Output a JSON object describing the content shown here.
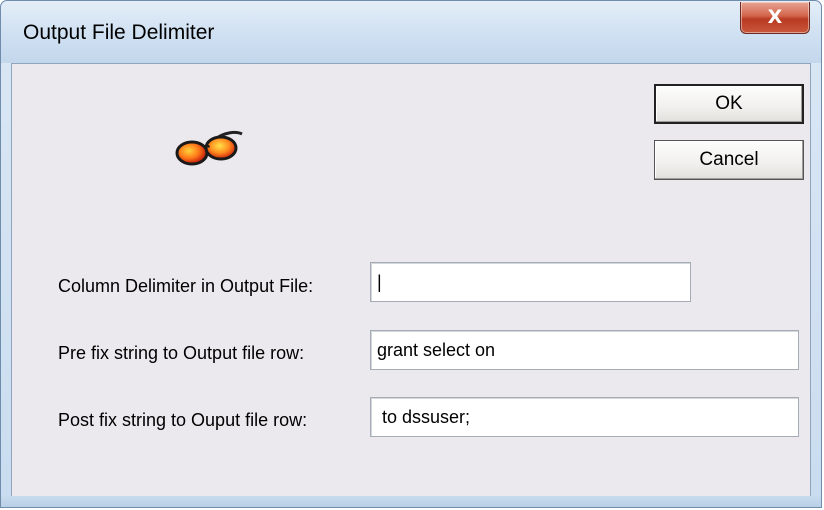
{
  "window": {
    "title": "Output File Delimiter",
    "close_label": "X"
  },
  "buttons": {
    "ok_label": "OK",
    "cancel_label": "Cancel"
  },
  "icons": {
    "glasses": "sunglasses-icon"
  },
  "fields": [
    {
      "label": "Column Delimiter in Output File:",
      "value": "|"
    },
    {
      "label": "Pre fix string to Output file row:",
      "value": "grant select on"
    },
    {
      "label": "Post fix string to Ouput file row:",
      "value": " to dssuser;"
    }
  ],
  "colors": {
    "client_background": "#ebe9ed",
    "frame": "#cfe0f2",
    "close_button": "#c9573c"
  }
}
